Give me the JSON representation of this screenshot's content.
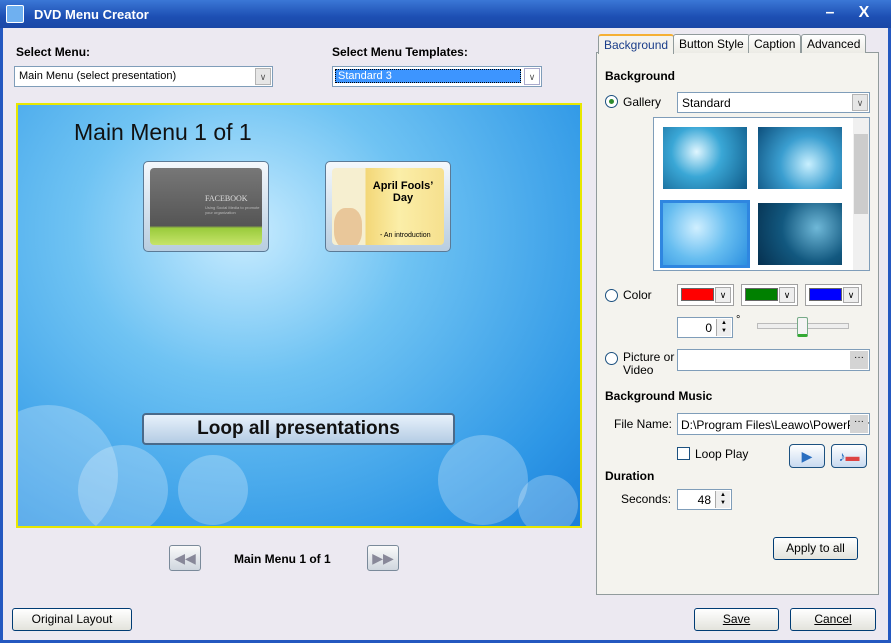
{
  "window": {
    "title": "DVD Menu Creator",
    "minimize": "–",
    "close": "X"
  },
  "left": {
    "select_menu_label": "Select Menu:",
    "select_menu_value": "Main Menu (select presentation)",
    "templates_label": "Select Menu Templates:",
    "templates_value": "Standard 3",
    "preview": {
      "title": "Main Menu 1 of 1",
      "thumbs": [
        {
          "heading": "FACEBOOK",
          "sub": "Using Social Media to promote your organization"
        },
        {
          "heading": "April Fools’ Day",
          "sub": "- An introduction"
        }
      ],
      "loop_button": "Loop all presentations"
    },
    "nav": {
      "prev": "◀◀",
      "label": "Main Menu 1 of 1",
      "next": "▶▶"
    }
  },
  "tabs": [
    "Background",
    "Button Style",
    "Caption",
    "Advanced"
  ],
  "background": {
    "section": "Background",
    "gallery_label": "Gallery",
    "gallery_value": "Standard",
    "color_label": "Color",
    "colors": [
      "#ff0000",
      "#008000",
      "#0000ff"
    ],
    "angle": "0",
    "degree": "°",
    "slider_fraction": 0.5,
    "picture_label": "Picture or Video",
    "picture_value": "",
    "music_section": "Background Music",
    "file_label": "File Name:",
    "file_value": "D:\\Program Files\\Leawo\\PowerPoint",
    "loop_play": "Loop Play",
    "duration_section": "Duration",
    "seconds_label": "Seconds:",
    "seconds_value": "48",
    "apply_all": "Apply to all",
    "browse": "···"
  },
  "footer": {
    "original_layout": "Original Layout",
    "save": "Save",
    "cancel": "Cancel"
  }
}
